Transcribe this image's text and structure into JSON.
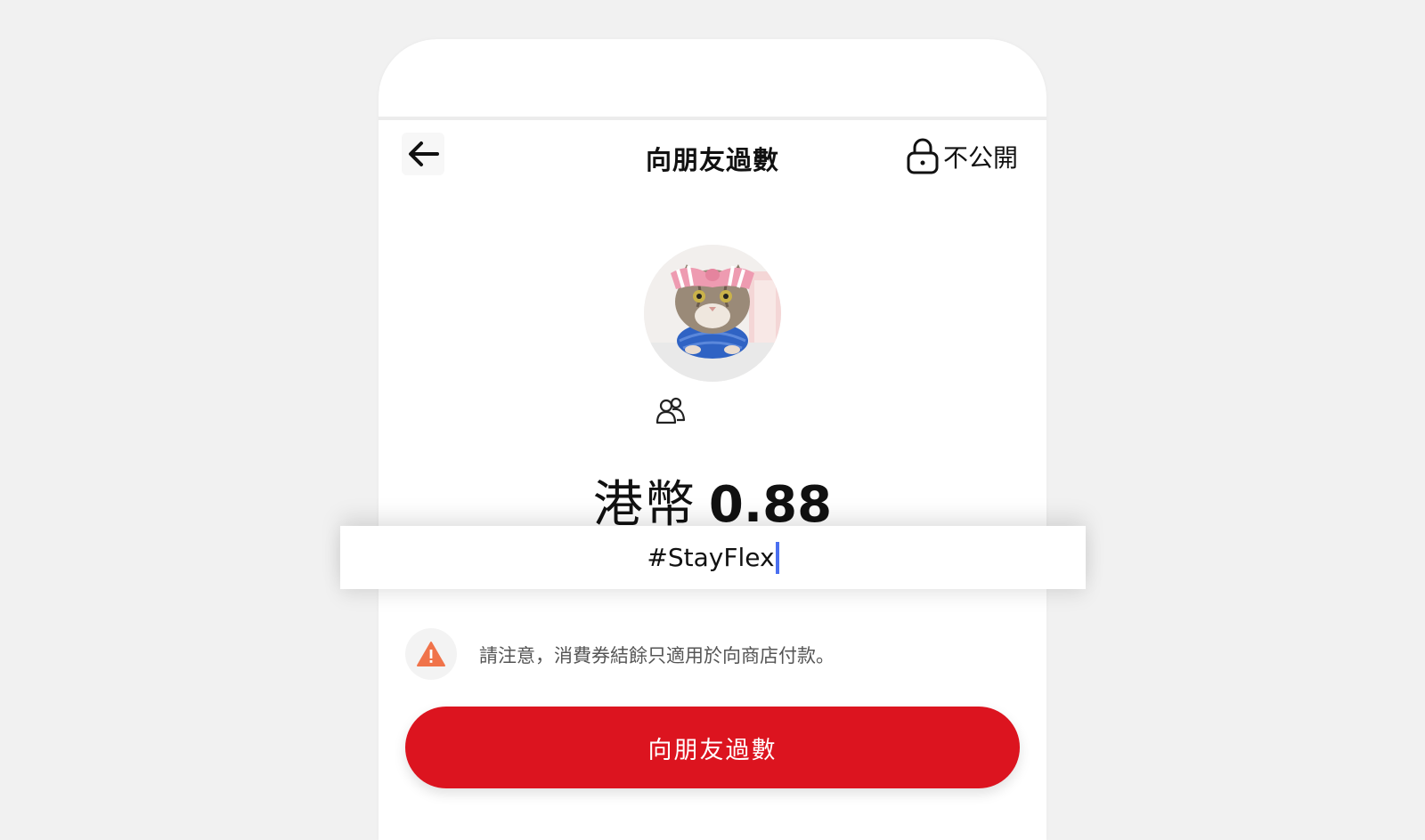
{
  "header": {
    "title": "向朋友過數",
    "privacy_label": "不公開"
  },
  "recipient": {
    "avatar_description": "cat-avatar",
    "group_icon": "friends-group-icon"
  },
  "amount": {
    "currency": "港幣",
    "value": "0.88"
  },
  "note": {
    "value": "#StayFlex"
  },
  "warning": {
    "text": "請注意，消費券結餘只適用於向商店付款。",
    "icon": "warning-icon"
  },
  "actions": {
    "submit_label": "向朋友過數"
  },
  "colors": {
    "primary": "#dc141f",
    "warning": "#f0734a",
    "caret": "#4a6ff0",
    "background": "#f1f1f1"
  }
}
